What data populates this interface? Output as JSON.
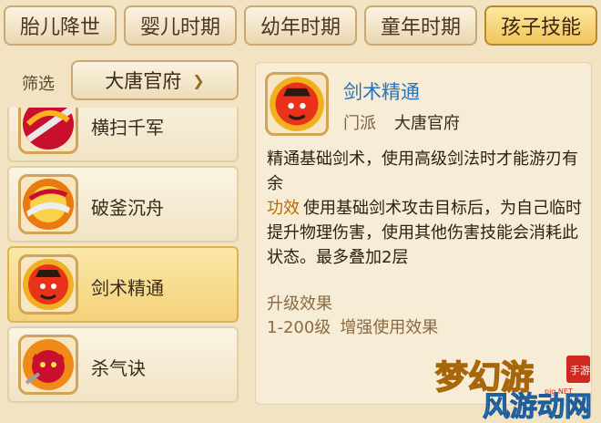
{
  "tabs": [
    {
      "label": "胎儿降世",
      "active": false
    },
    {
      "label": "婴儿时期",
      "active": false
    },
    {
      "label": "幼年时期",
      "active": false
    },
    {
      "label": "童年时期",
      "active": false
    },
    {
      "label": "孩子技能",
      "active": true
    }
  ],
  "filter": {
    "label": "筛选",
    "selected": "大唐官府",
    "icon": "chevron-down-icon"
  },
  "skills": [
    {
      "name": "横扫千军",
      "icon": "sword-sweep-icon"
    },
    {
      "name": "破釜沉舟",
      "icon": "flaming-wave-icon"
    },
    {
      "name": "剑术精通",
      "icon": "red-warrior-icon",
      "selected": true
    },
    {
      "name": "杀气诀",
      "icon": "red-demon-icon"
    }
  ],
  "detail": {
    "icon": "red-warrior-icon",
    "title": "剑术精通",
    "school_label": "门派",
    "school": "大唐官府",
    "description": "精通基础剑术，使用高级剑法时才能游刃有余",
    "effect_label": "功效",
    "effect_text": "使用基础剑术攻击目标后，为自己临时提升物理伤害，使用其他伤害技能会消耗此状态。最多叠加2层",
    "upgrade_title": "升级效果",
    "upgrade_level": "1-200级",
    "upgrade_text": "增强使用效果"
  },
  "watermark": {
    "text": "梦幻游",
    "sub_text": "风游动网",
    "small_text": "手游",
    "domain": "pig.NET"
  },
  "colors": {
    "active_tab": "#f1c55b",
    "title_blue": "#2a72b8",
    "effect_orange": "#b86a00"
  }
}
